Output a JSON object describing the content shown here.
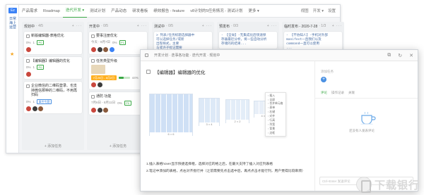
{
  "sidebar": {
    "badge": "Ez",
    "title": "日常海上运营",
    "star": "★"
  },
  "nav": {
    "items": [
      "产品需求",
      "Roadmap",
      "迭代开发 ▾",
      "测试计划",
      "产品动态",
      "研发看板",
      "绩效报告 - feature",
      "v8计划的5任务情况 - 测试计划",
      "更多 ▾"
    ],
    "right": [
      "视图",
      "开发 ▾",
      "设置"
    ]
  },
  "columns": [
    {
      "title": "规划中",
      "count": "· 4/5",
      "cards": [
        {
          "title": "新版编辑器-表格优化",
          "meta": [
            "0%",
            "1"
          ],
          "tag": "P0"
        },
        {
          "title": "【编辑器】编辑器的优化",
          "meta": [
            "0%",
            "1"
          ],
          "tag": "P0"
        },
        {
          "title": "企业微信的二维码登录、也支持微信那种的二维码，不用再扫码",
          "meta": [
            "0%",
            "1"
          ],
          "tag": "事件专题"
        }
      ]
    },
    {
      "title": "开发中",
      "count": "· 0/5",
      "cards": [
        {
          "title": "要事注册优化",
          "meta": [
            "今天 - 8月7日",
            "0%",
            "1"
          ],
          "tag": "P1"
        },
        {
          "title": "任务类型升级",
          "meta": [
            "7月25日 - 8月2日",
            "44%"
          ],
          "tag": "P1"
        },
        {
          "title": "通防 功能",
          "meta": [
            "7月6日 - 8月11日",
            "0%",
            "1"
          ],
          "tag": "P0"
        }
      ]
    },
    {
      "title": "测试中",
      "count": "· 0/5",
      "code": "> 列表/任务标题选择器中\n可以选择任务/或新\n出现样式，主要\n与或许子标记需要"
    },
    {
      "title": "预发布",
      "count": "· 0/3",
      "code": "- 【全局】-无集成化后快速保\n存器最近分析，将一些自动分析\n存储的的结果..."
    },
    {
      "title": "临时发布 - 2020-7-28",
      "count": "· 1/3",
      "code": "- 【不协知人】-手机对外部\nmanifest一直我们以及\ncommand一直可以使用\n..."
    }
  ],
  "add_task": "+ 添加任务",
  "dialog": {
    "breadcrumb": "开发计划 · 迭事各功能 · 迭代开发 · 规划中",
    "tools": [
      "⧉",
      "↻",
      "✕"
    ],
    "title": "【编辑器】编辑器的优化",
    "images": [
      {
        "caption": "6 × 6"
      },
      {
        "caption": "3 × 4"
      },
      {
        "caption": "2 × 2"
      },
      {
        "caption": "4 × 2"
      }
    ],
    "menu": [
      "插入",
      "全屏",
      "合并单元格",
      "表单",
      "右键",
      "对齐",
      "行高",
      "列宽",
      "背景",
      "边框"
    ],
    "notes": [
      "1.插入表格hover显示快捷选择框，选择对应的格之后，在最大支持了插入对应列表格",
      "2.笔记中添加的表格，点右对齐指行并（之前需要先点击选中后，再点点击才能行列，用户觉得比较麻烦）"
    ],
    "right": {
      "label": "添加任务",
      "plus": "+",
      "tabs": [
        "评论",
        "操作记录",
        "关联"
      ],
      "empty": "还没有人发表评论",
      "input": "Ctrl+Enter 发送评论"
    }
  },
  "watermark": "下载银行"
}
